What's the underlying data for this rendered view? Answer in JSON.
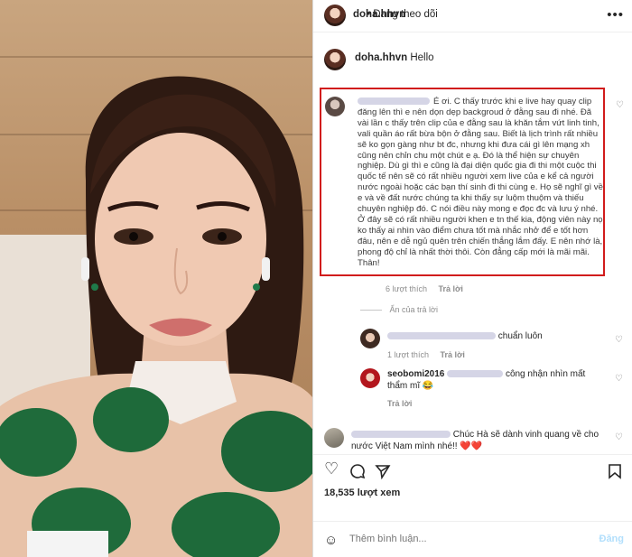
{
  "header": {
    "username": "doha.hhvn",
    "separator": "•",
    "follow_status": "Đang theo dõi",
    "more": "•••"
  },
  "caption": {
    "username": "doha.hhvn",
    "text": "Hello"
  },
  "main_comment": {
    "text": "É ơi. C thấy trước khi e live hay quay clip đăng lên thì e nên dọn dẹp backgroud ở đằng sau đi nhé. Đã vài lần c thấy trên clip của e đằng sau là khăn tắm vứt linh tinh, vali quần áo rất bừa bộn ở đằng sau. Biết là lịch trình rất nhiều sẽ ko gọn gàng như bt đc, nhưng khi đưa cái gì lên mạng xh cũng nên chỉn chu một chút e ạ. Đó là thể hiện sự chuyên nghiệp. Dù gì thì e cũng là đại diện quốc gia đi thi một cuộc thi quốc tế nên sẽ có rất nhiều người xem live của e kể cả người nước ngoài hoặc các bạn thí sinh đi thi cùng e. Họ sẽ nghĩ gì về e và về đất nước chúng ta khi thấy sự luộm thuộm và thiếu chuyên nghiệp đó. C nói điều này mong e đọc đc và lưu ý nhé. Ở đây sẽ có rất nhiều người khen e tn thế kia, động viên này nọ ko thấy ai nhìn vào điểm chưa tốt mà nhắc nhở để e tốt hơn đâu, nên e dễ ngủ quên trên chiến thắng lắm đấy. E nên nhớ là, phong độ chỉ là nhất thời thôi. Còn đẳng cấp mới là mãi mãi. Thân!",
    "likes": "6 lượt thích",
    "reply": "Trả lời"
  },
  "hide_replies": "Ẩn của trả lời",
  "replies": [
    {
      "text": "chuẩn luôn",
      "likes": "1 lượt thích",
      "reply": "Trả lời"
    },
    {
      "username": "seobomi2016",
      "text": "công nhận nhìn mất",
      "text2": "thẩm mĩ 😂",
      "reply": "Trả lời",
      "emojis": "😆😆"
    }
  ],
  "bottom_comment": {
    "text": "Chúc Hà sẽ dành vinh quang về cho",
    "text2": "nước Việt Nam mình nhé!! ❤️❤️"
  },
  "actions": {
    "like_icon": "heart-icon",
    "comment_icon": "comment-icon",
    "share_icon": "share-icon",
    "save_icon": "bookmark-icon",
    "views": "18,535 lượt xem"
  },
  "add_comment": {
    "placeholder": "Thêm bình luận...",
    "post": "Đăng"
  },
  "colors": {
    "highlight_border": "#d11c1c",
    "heart_red": "#ed4956"
  }
}
